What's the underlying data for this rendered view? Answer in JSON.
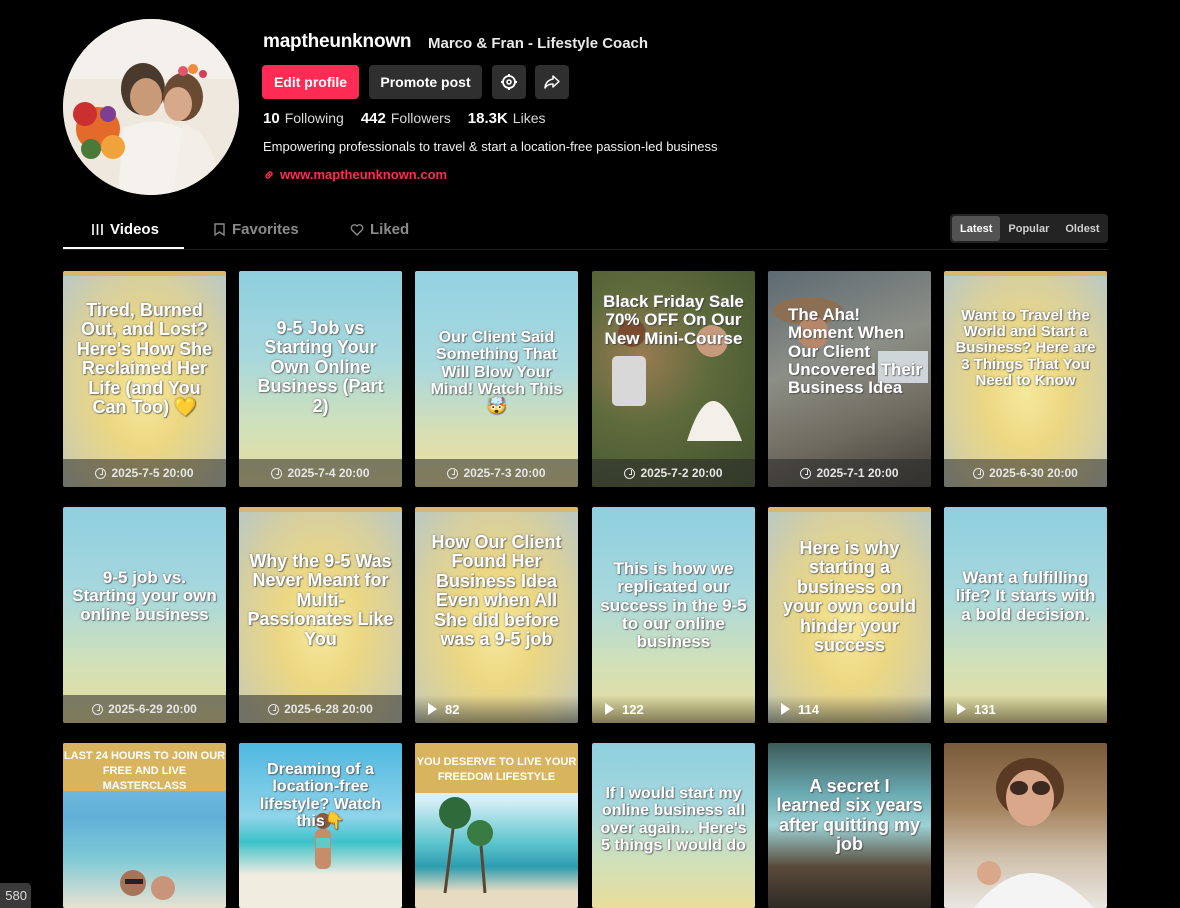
{
  "profile": {
    "username": "maptheunknown",
    "nickname": "Marco & Fran - Lifestyle Coach",
    "edit_label": "Edit profile",
    "promote_label": "Promote post",
    "following_count": "10",
    "following_label": "Following",
    "followers_count": "442",
    "followers_label": "Followers",
    "likes_count": "18.3K",
    "likes_label": "Likes",
    "bio": "Empowering professionals to travel & start a location-free passion-led business",
    "link": "www.maptheunknown.com",
    "icons": [
      "settings-icon",
      "share-icon",
      "link-icon"
    ]
  },
  "tabs": {
    "videos": "Videos",
    "favorites": "Favorites",
    "liked": "Liked",
    "active": "Videos"
  },
  "sort": {
    "latest": "Latest",
    "popular": "Popular",
    "oldest": "Oldest",
    "active": "Latest"
  },
  "accent_color": "#fe2c55",
  "videos": [
    {
      "text": "Tired, Burned Out, and Lost? Here's How She Reclaimed Her Life (and You Can Too) 💛",
      "date": "2025-7-5 20:00"
    },
    {
      "text": "9-5 Job vs Starting Your Own Online Business (Part 2)",
      "date": "2025-7-4 20:00"
    },
    {
      "text": "Our Client Said Something That Will Blow Your Mind! Watch This 🤯",
      "date": "2025-7-3 20:00"
    },
    {
      "text": "Black Friday Sale 70% OFF On Our New Mini-Course",
      "date": "2025-7-2 20:00"
    },
    {
      "text": "The Aha! Moment When Our Client Uncovered Their Business Idea",
      "date": "2025-7-1 20:00"
    },
    {
      "text": "Want to Travel the World and Start a Business? Here are 3 Things That You Need to Know",
      "date": "2025-6-30 20:00"
    },
    {
      "text": "9-5 job vs. Starting your own online business",
      "date": "2025-6-29 20:00"
    },
    {
      "text": "Why the 9-5 Was Never Meant for Multi-Passionates Like You",
      "date": "2025-6-28 20:00"
    },
    {
      "text": "How Our Client Found Her Business Idea Even when All She did before was a 9-5 job",
      "views": "82"
    },
    {
      "text": "This is how we replicated our success in the 9-5 to our online business",
      "views": "122"
    },
    {
      "text": "Here is why starting a business on your own could hinder your success",
      "views": "114"
    },
    {
      "text": "Want a fulfilling life? It starts with a bold decision.",
      "views": "131"
    },
    {
      "text": "LAST 24 HOURS TO JOIN OUR FREE AND LIVE MASTERCLASS"
    },
    {
      "text": "Dreaming of a location-free lifestyle? Watch this👇"
    },
    {
      "text": "YOU DESERVE TO LIVE YOUR FREEDOM LIFESTYLE"
    },
    {
      "text": "If I would start my online business all over again... Here's 5 things I would do"
    },
    {
      "text": "A secret I learned six years after quitting my job"
    },
    {
      "text": ""
    }
  ],
  "corner_badge": "580"
}
